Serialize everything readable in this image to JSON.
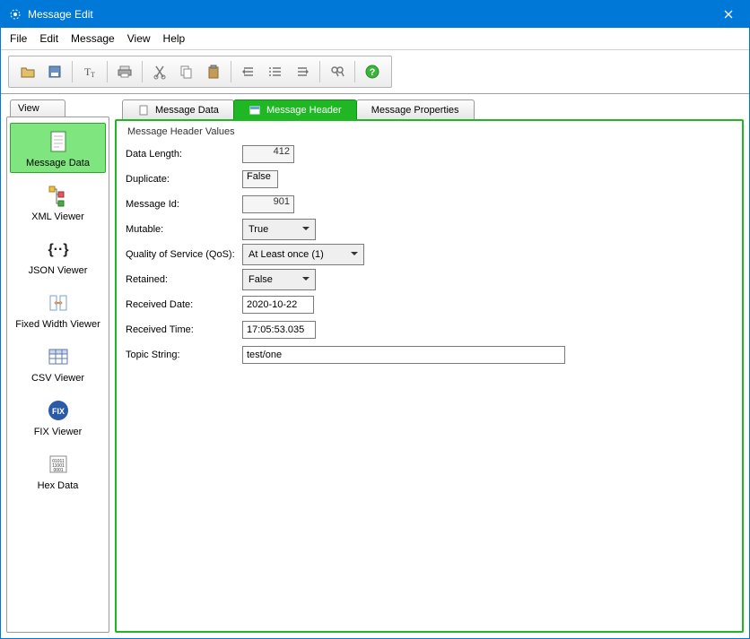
{
  "window": {
    "title": "Message Edit"
  },
  "menu": {
    "file": "File",
    "edit": "Edit",
    "message": "Message",
    "view": "View",
    "help": "Help"
  },
  "sidebar": {
    "tab_label": "View",
    "items": [
      {
        "label": "Message Data"
      },
      {
        "label": "XML Viewer"
      },
      {
        "label": "JSON Viewer"
      },
      {
        "label": "Fixed Width Viewer"
      },
      {
        "label": "CSV Viewer"
      },
      {
        "label": "FIX Viewer"
      },
      {
        "label": "Hex Data"
      }
    ]
  },
  "tabs": {
    "data": "Message Data",
    "header": "Message Header",
    "props": "Message Properties"
  },
  "group_label": "Message Header Values",
  "fields": {
    "data_length": {
      "label": "Data Length:",
      "value": "412"
    },
    "duplicate": {
      "label": "Duplicate:",
      "value": "False"
    },
    "message_id": {
      "label": "Message Id:",
      "value": "901"
    },
    "mutable": {
      "label": "Mutable:",
      "value": "True"
    },
    "qos": {
      "label": "Quality of Service (QoS):",
      "value": "At Least once (1)"
    },
    "retained": {
      "label": "Retained:",
      "value": "False"
    },
    "recv_date": {
      "label": "Received Date:",
      "value": "2020-10-22"
    },
    "recv_time": {
      "label": "Received Time:",
      "value": "17:05:53.035"
    },
    "topic": {
      "label": "Topic String:",
      "value": "test/one"
    }
  }
}
